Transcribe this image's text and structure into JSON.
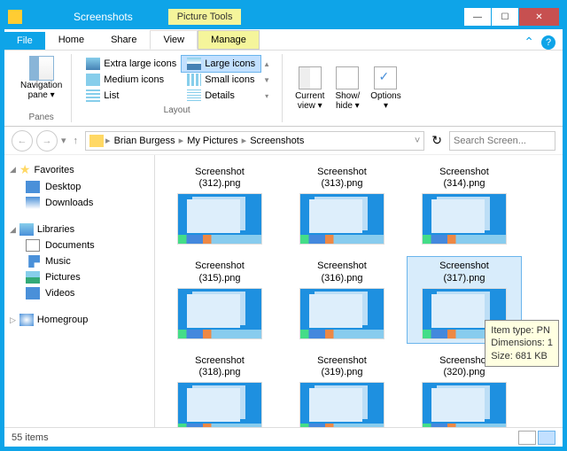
{
  "title": "Screenshots",
  "tool_tab": "Picture Tools",
  "win": {
    "min": "—",
    "max": "☐",
    "close": "✕"
  },
  "tabs": {
    "file": "File",
    "home": "Home",
    "share": "Share",
    "view": "View",
    "manage": "Manage"
  },
  "ribbon": {
    "panes_label": "Panes",
    "nav_pane": "Navigation\npane ▾",
    "layout_label": "Layout",
    "layouts": {
      "xl": "Extra large icons",
      "l": "Large icons",
      "m": "Medium icons",
      "s": "Small icons",
      "list": "List",
      "det": "Details"
    },
    "current_view": "Current\nview ▾",
    "show_hide": "Show/\nhide ▾",
    "options": "Options\n▾"
  },
  "addr": {
    "back": "←",
    "fwd": "→",
    "drop": "▾",
    "up": "↑",
    "crumbs": [
      "Brian Burgess",
      "My Pictures",
      "Screenshots"
    ],
    "sep": "▸",
    "cdrop": "˅",
    "refresh": "↻"
  },
  "search_placeholder": "Search Screen...",
  "sidebar": {
    "favorites": "Favorites",
    "desktop": "Desktop",
    "downloads": "Downloads",
    "libraries": "Libraries",
    "documents": "Documents",
    "music": "Music",
    "pictures": "Pictures",
    "videos": "Videos",
    "homegroup": "Homegroup",
    "exp": "▷",
    "exp_open": "◢"
  },
  "files": [
    {
      "name": "Screenshot (312).png"
    },
    {
      "name": "Screenshot (313).png"
    },
    {
      "name": "Screenshot (314).png"
    },
    {
      "name": "Screenshot (315).png"
    },
    {
      "name": "Screenshot (316).png"
    },
    {
      "name": "Screenshot (317).png"
    },
    {
      "name": "Screenshot (318).png"
    },
    {
      "name": "Screenshot (319).png"
    },
    {
      "name": "Screenshot (320).png"
    }
  ],
  "selected_index": 5,
  "tooltip": {
    "l1": "Item type: PN",
    "l2": "Dimensions: 1",
    "l3": "Size: 681 KB"
  },
  "status": "55 items",
  "help": {
    "caret": "⌃",
    "q": "?"
  }
}
